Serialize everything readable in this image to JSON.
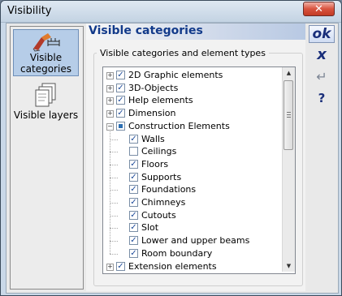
{
  "window": {
    "title": "Visibility",
    "close_icon": "close-icon"
  },
  "sidebar": {
    "items": [
      {
        "label": "Visible categories",
        "icon": "visible-categories-icon",
        "active": true
      },
      {
        "label": "Visible layers",
        "icon": "visible-layers-icon",
        "active": false
      }
    ]
  },
  "header": {
    "title": "Visible categories"
  },
  "group": {
    "label": "Visible categories and element types"
  },
  "tree": {
    "rows": [
      {
        "label": "2D Graphic elements",
        "expander": "+",
        "state": "checked",
        "level": 0
      },
      {
        "label": "3D-Objects",
        "expander": "+",
        "state": "checked",
        "level": 0
      },
      {
        "label": "Help elements",
        "expander": "+",
        "state": "checked",
        "level": 0
      },
      {
        "label": "Dimension",
        "expander": "+",
        "state": "checked",
        "level": 0
      },
      {
        "label": "Construction Elements",
        "expander": "−",
        "state": "partial",
        "level": 0
      },
      {
        "label": "Walls",
        "state": "checked",
        "level": 1
      },
      {
        "label": "Ceilings",
        "state": "unchecked",
        "level": 1
      },
      {
        "label": "Floors",
        "state": "checked",
        "level": 1
      },
      {
        "label": "Supports",
        "state": "checked",
        "level": 1
      },
      {
        "label": "Foundations",
        "state": "checked",
        "level": 1
      },
      {
        "label": "Chimneys",
        "state": "checked",
        "level": 1
      },
      {
        "label": "Cutouts",
        "state": "checked",
        "level": 1
      },
      {
        "label": "Slot",
        "state": "checked",
        "level": 1
      },
      {
        "label": "Lower and upper beams",
        "state": "checked",
        "level": 1
      },
      {
        "label": "Room boundary",
        "state": "checked",
        "level": 1
      },
      {
        "label": "Extension elements",
        "expander": "+",
        "state": "checked",
        "level": 0
      }
    ]
  },
  "actions": {
    "ok_label": "ok",
    "cancel_label": "x",
    "apply_label": "↵",
    "help_label": "?"
  },
  "colors": {
    "header_text": "#123a8a",
    "check": "#1c4a9a",
    "close_button": "#c23a24"
  }
}
